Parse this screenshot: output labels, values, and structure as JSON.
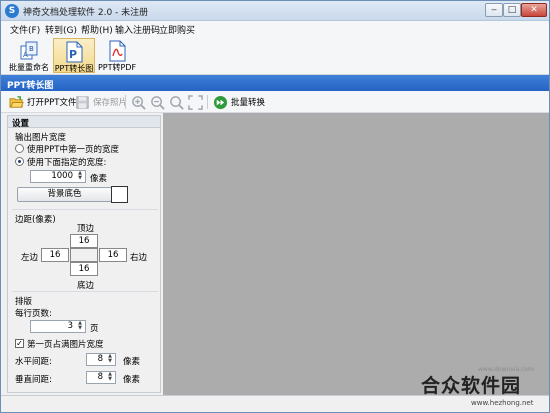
{
  "window": {
    "title": "神奇文档处理软件 2.0 - 未注册",
    "controls": {
      "minimize": "‒",
      "maximize": "□",
      "close": "✕"
    }
  },
  "menu": [
    {
      "label": "文件(F)"
    },
    {
      "label": "转到(G)"
    },
    {
      "label": "帮助(H)"
    },
    {
      "label": "输入注册码"
    },
    {
      "label": "立即购买"
    }
  ],
  "ribbon": [
    {
      "label": "批量重命名",
      "icon": "rename-icon",
      "active": false
    },
    {
      "label": "PPT转长图",
      "icon": "ppt-icon",
      "active": true
    },
    {
      "label": "PPT转PDF",
      "icon": "pdf-icon",
      "active": false
    }
  ],
  "section_title": "PPT转长图",
  "toolbar": {
    "open": "打开PPT文件",
    "save": "保存照片",
    "batch": "批量转换"
  },
  "panel": {
    "header": "设置",
    "output_width": {
      "title": "输出图片宽度",
      "option1": "使用PPT中第一页的宽度",
      "option2": "使用下面指定的宽度:",
      "selected": 2,
      "width_value": "1000",
      "unit": "像素",
      "bg_button": "背景底色",
      "bg_color": "#ffffff"
    },
    "margins": {
      "title": "边距(像素)",
      "top_label": "顶边",
      "bottom_label": "底边",
      "left_label": "左边",
      "right_label": "右边",
      "top": "16",
      "bottom": "16",
      "left": "16",
      "right": "16"
    },
    "layout": {
      "title": "排版",
      "per_row_label": "每行页数:",
      "per_row_value": "3",
      "per_row_unit": "页",
      "first_page_label": "第一页占满图片宽度",
      "first_page_checked": true,
      "h_gap_label": "水平间距:",
      "h_gap_value": "8",
      "v_gap_label": "垂直间距:",
      "v_gap_value": "8",
      "gap_unit": "像素"
    }
  },
  "watermark": {
    "faint": "www.downxia.com",
    "brand": "合众软件园",
    "url": "www.hezhong.net"
  }
}
